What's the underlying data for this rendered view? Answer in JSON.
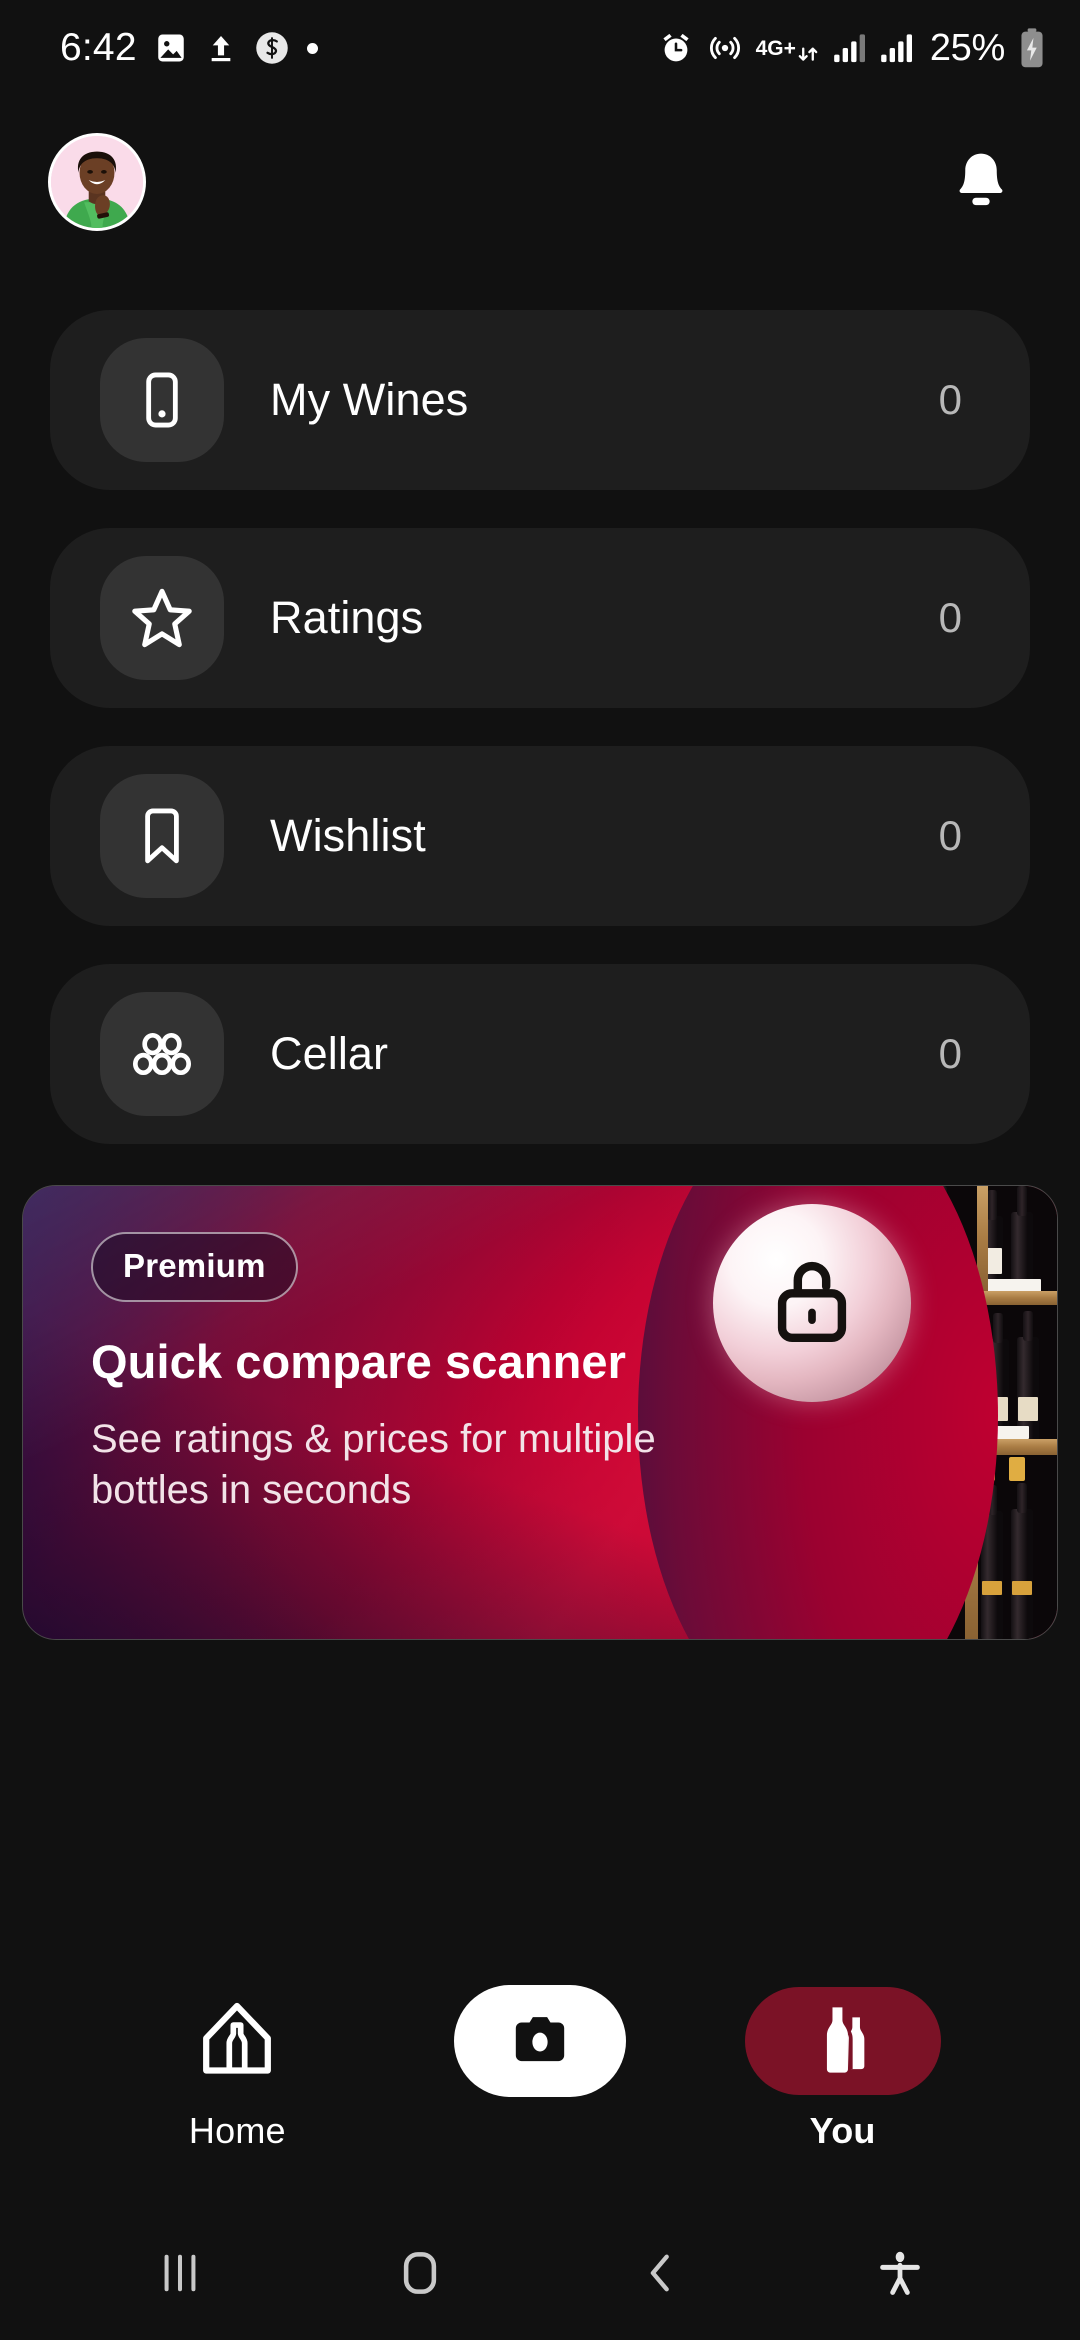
{
  "status_bar": {
    "time": "6:42",
    "left_icons": [
      "image-icon",
      "upload-icon",
      "s-circle-icon",
      "dot-icon"
    ],
    "network_label": "4G+",
    "battery_percent": "25%",
    "right_icons": [
      "alarm-icon",
      "hotspot-icon",
      "network-4gplus-icon",
      "signal-bars-icon-1",
      "signal-bars-icon-2",
      "battery-charging-icon"
    ]
  },
  "header": {
    "avatar": "user-avatar",
    "notification_icon": "bell-icon"
  },
  "menu": {
    "items": [
      {
        "label": "My Wines",
        "count": "0",
        "icon": "wine-label-icon"
      },
      {
        "label": "Ratings",
        "count": "0",
        "icon": "star-icon"
      },
      {
        "label": "Wishlist",
        "count": "0",
        "icon": "bookmark-icon"
      },
      {
        "label": "Cellar",
        "count": "0",
        "icon": "bottle-rack-icon"
      }
    ]
  },
  "banner": {
    "badge": "Premium",
    "title": "Quick compare scanner",
    "subtitle": "See ratings & prices for multiple bottles in seconds",
    "lock_icon": "unlock-icon",
    "photo": "wine-shelf-photo",
    "accent_color": "#c20030",
    "deep_color": "#2a1046"
  },
  "bottom_nav": {
    "items": [
      {
        "label": "Home",
        "icon": "home-bottle-icon",
        "active": false
      },
      {
        "label": "",
        "icon": "camera-icon",
        "active": false
      },
      {
        "label": "You",
        "icon": "two-bottles-icon",
        "active": true
      }
    ],
    "active_pill_color": "#7b1226"
  },
  "android_nav": {
    "buttons": [
      "recents-icon",
      "home-icon",
      "back-icon",
      "accessibility-icon"
    ]
  }
}
